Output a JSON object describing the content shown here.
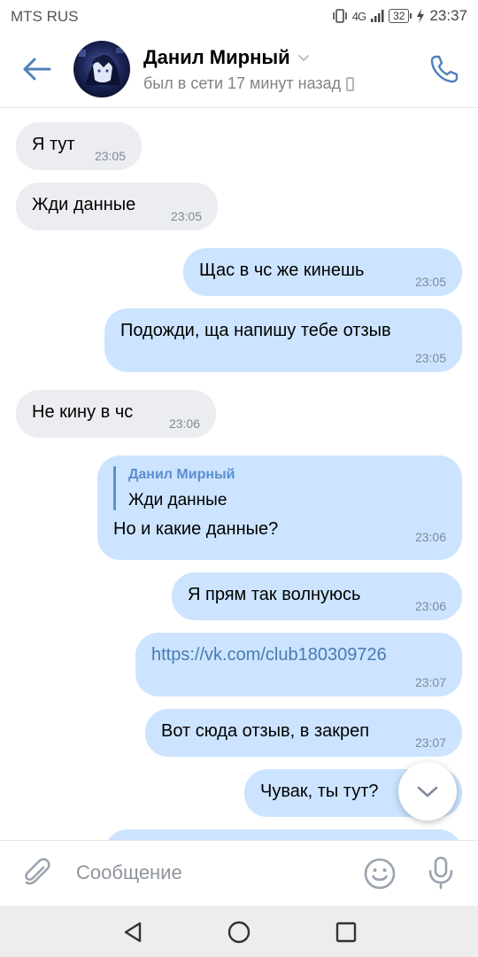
{
  "status_bar": {
    "carrier": "MTS RUS",
    "signal": "4G",
    "battery": "32",
    "time": "23:37"
  },
  "header": {
    "contact_name": "Данил Мирный",
    "last_seen": "был в сети 17 минут назад"
  },
  "messages": [
    {
      "direction": "in",
      "text": "Я тут",
      "time": "23:05"
    },
    {
      "direction": "in",
      "text": "Жди данные",
      "time": "23:05"
    },
    {
      "direction": "out",
      "text": "Щас в чс же кинешь",
      "time": "23:05"
    },
    {
      "direction": "out",
      "text": "Подожди, ща напишу тебе отзыв",
      "time": "23:05"
    },
    {
      "direction": "in",
      "text": "Не кину в чс",
      "time": "23:06"
    },
    {
      "direction": "out",
      "reply_to": {
        "author": "Данил Мирный",
        "text": "Жди данные"
      },
      "text": "Но и какие данные?",
      "time": "23:06"
    },
    {
      "direction": "out",
      "text": "Я прям так волнуюсь",
      "time": "23:06"
    },
    {
      "direction": "out",
      "text": "https://vk.com/club180309726",
      "time": "23:07"
    },
    {
      "direction": "out",
      "text": "Вот сюда отзыв, в закреп",
      "time": "23:07"
    },
    {
      "direction": "out",
      "text": "Чувак, ты тут?"
    }
  ],
  "composer": {
    "placeholder": "Сообщение"
  },
  "colors": {
    "accent": "#5181b8",
    "incoming_bubble": "#ebedf0",
    "outgoing_bubble": "#cce4ff"
  },
  "icons": {
    "back": "arrow-left-icon",
    "call": "phone-icon",
    "attach": "paperclip-icon",
    "emoji": "smile-icon",
    "voice": "microphone-icon",
    "scroll": "chevron-down-icon"
  }
}
